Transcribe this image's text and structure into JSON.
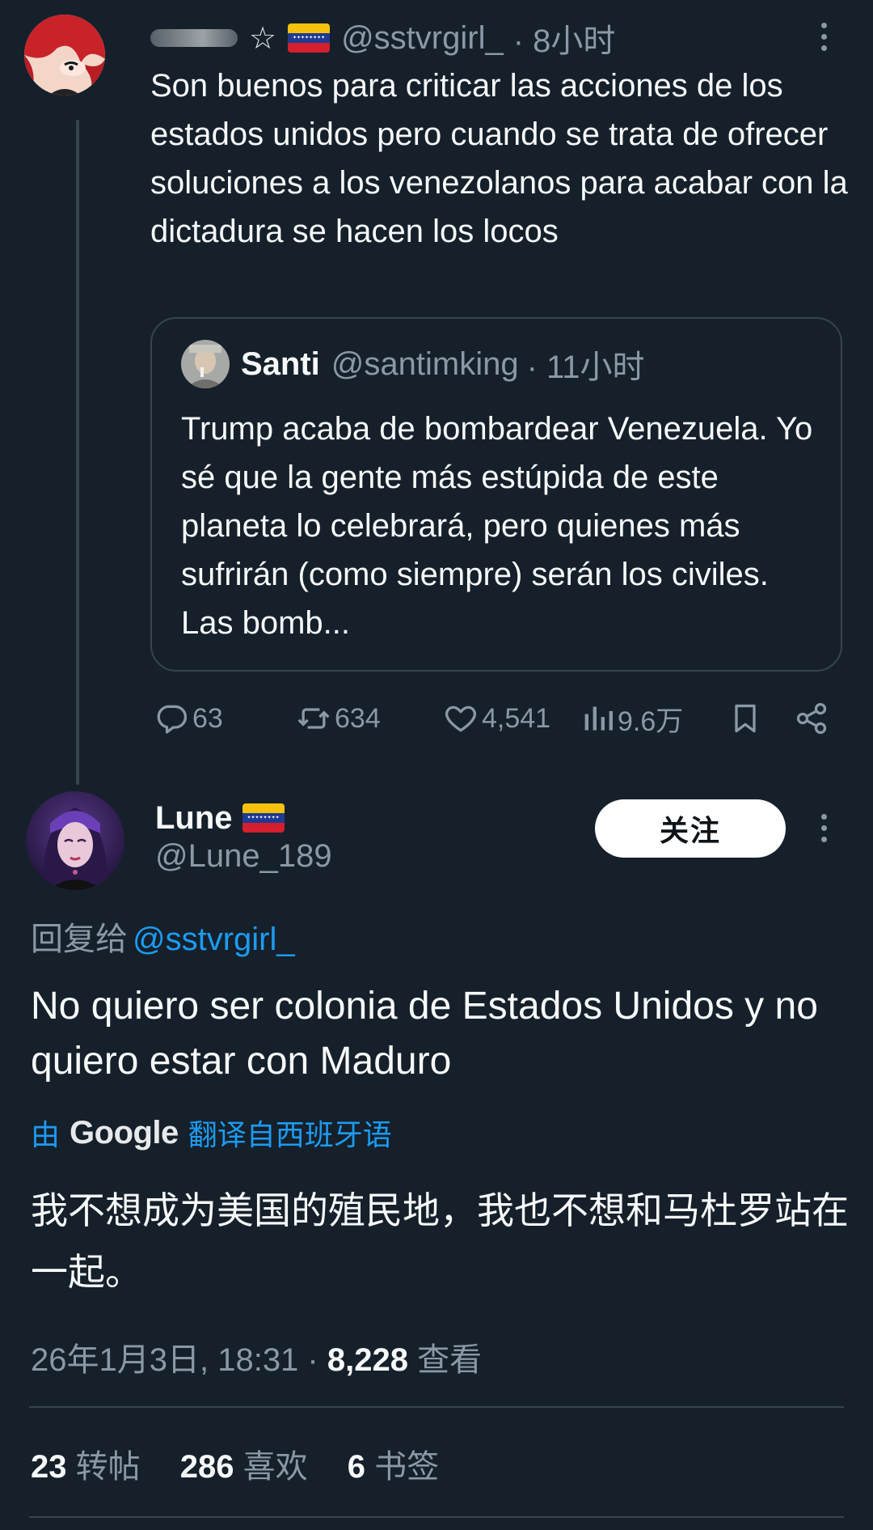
{
  "parent_tweet": {
    "star": "☆",
    "handle": "@sstvrgirl_",
    "time": "· 8小时",
    "text": "Son buenos para criticar las acciones de los estados unidos pero cuando se trata de ofrecer soluciones a los venezolanos para acabar con la dictadura se hacen los locos",
    "quote": {
      "name": "Santi",
      "handle": "@santimking",
      "time": "· 11小时",
      "text": "Trump acaba de bombardear Venezuela. Yo sé que la gente más estúpida de este planeta lo celebrará, pero quienes más sufrirán (como siempre) serán los civiles. Las bomb..."
    },
    "actions": {
      "replies": "63",
      "reposts": "634",
      "likes": "4,541",
      "views": "9.6万"
    }
  },
  "main_tweet": {
    "name": "Lune",
    "handle": "@Lune_189",
    "follow_label": "关注",
    "reply_prefix": "回复给",
    "reply_handle": "@sstvrgirl_",
    "text": "No quiero ser colonia de Estados Unidos y no quiero estar con Maduro",
    "translate_prefix": "由",
    "translate_brand": "Google",
    "translate_suffix": "翻译自西班牙语",
    "translated_text": "我不想成为美国的殖民地，我也不想和马杜罗站在一起。",
    "timestamp": "26年1月3日, 18:31 ·",
    "views_count": "8,228",
    "views_label": "查看",
    "stats": {
      "reposts_count": "23",
      "reposts_label": "转帖",
      "likes_count": "286",
      "likes_label": "喜欢",
      "bookmarks_count": "6",
      "bookmarks_label": "书签"
    }
  },
  "colors": {
    "background": "#15202b",
    "text": "#f7f9f9",
    "secondary": "#8b98a5",
    "accent": "#1d9bf0",
    "border": "#38444d"
  }
}
